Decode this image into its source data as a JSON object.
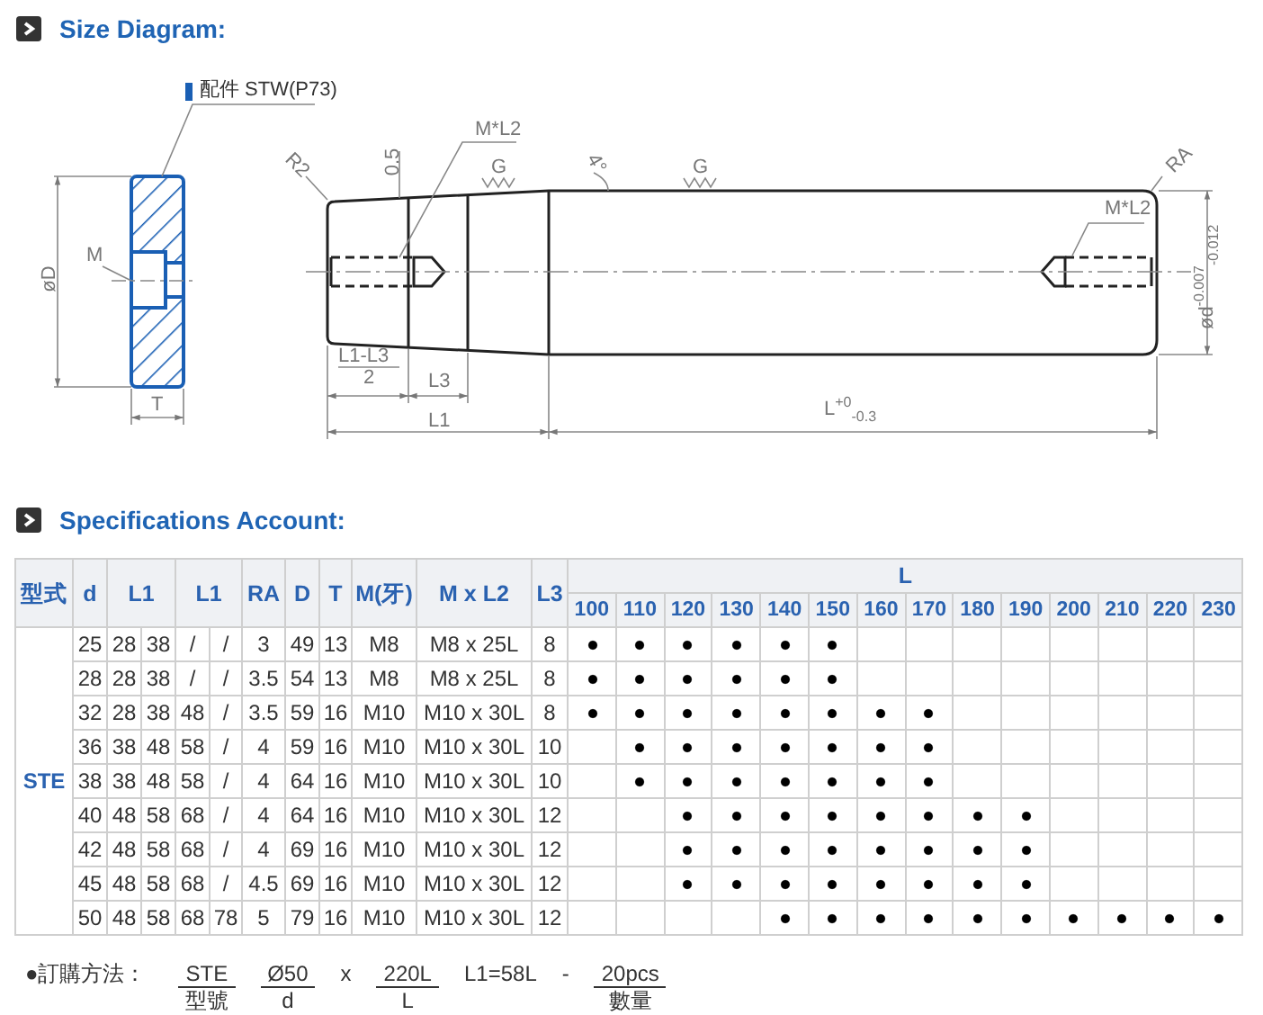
{
  "sections": [
    {
      "title": "Size Diagram:"
    },
    {
      "title": "Specifications Account:"
    }
  ],
  "diagram": {
    "labels": [
      {
        "text": "配件 STW(P73)",
        "kind": "callout"
      },
      {
        "text": "øD",
        "kind": "dimension"
      },
      {
        "text": "M",
        "kind": "dimension"
      },
      {
        "text": "T",
        "kind": "dimension"
      },
      {
        "text": "R2",
        "kind": "dimension"
      },
      {
        "text": "0.5",
        "kind": "dimension"
      },
      {
        "text": "M*L2",
        "kind": "dimension"
      },
      {
        "text": "G",
        "kind": "dimension"
      },
      {
        "text": "4°",
        "kind": "dimension"
      },
      {
        "text": "G",
        "kind": "dimension"
      },
      {
        "text": "RA",
        "kind": "dimension"
      },
      {
        "text": "M*L2",
        "kind": "dimension"
      },
      {
        "text": "ød$^{-0.007}$$_{-0.012}$",
        "kind": "dimension"
      },
      {
        "text": "L1-L3",
        "kind": "dimension"
      },
      {
        "text": "2",
        "kind": "dimension"
      },
      {
        "text": "L3",
        "kind": "dimension"
      },
      {
        "text": "L1",
        "kind": "dimension"
      },
      {
        "text": "L$^{+0}$$_{-0.3}$",
        "kind": "dimension"
      }
    ]
  },
  "table": {
    "columns": [
      {
        "label": "型式",
        "kind": "single"
      },
      {
        "label": "d",
        "kind": "single"
      },
      {
        "label": "L1",
        "kind": "pair"
      },
      {
        "label": "L1",
        "kind": "pair"
      },
      {
        "label": "RA",
        "kind": "single"
      },
      {
        "label": "D",
        "kind": "single"
      },
      {
        "label": "T",
        "kind": "single"
      },
      {
        "label": "M(牙)",
        "kind": "single"
      },
      {
        "label": "M x L2",
        "kind": "single"
      },
      {
        "label": "L3",
        "kind": "single"
      }
    ],
    "length_group": {
      "label": "L",
      "sizes": [
        "100",
        "110",
        "120",
        "130",
        "140",
        "150",
        "160",
        "170",
        "180",
        "190",
        "200",
        "210",
        "220",
        "230"
      ]
    },
    "groups": [
      {
        "type": "STE",
        "rows": [
          {
            "cells": [
              "25",
              "28",
              "38",
              "/",
              "/",
              "3",
              "49",
              "13",
              "M8",
              "M8 x 25L",
              "8"
            ],
            "available": [
              true,
              true,
              true,
              true,
              true,
              true,
              false,
              false,
              false,
              false,
              false,
              false,
              false,
              false
            ]
          },
          {
            "cells": [
              "28",
              "28",
              "38",
              "/",
              "/",
              "3.5",
              "54",
              "13",
              "M8",
              "M8 x 25L",
              "8"
            ],
            "available": [
              true,
              true,
              true,
              true,
              true,
              true,
              false,
              false,
              false,
              false,
              false,
              false,
              false,
              false
            ]
          },
          {
            "cells": [
              "32",
              "28",
              "38",
              "48",
              "/",
              "3.5",
              "59",
              "16",
              "M10",
              "M10 x 30L",
              "8"
            ],
            "available": [
              true,
              true,
              true,
              true,
              true,
              true,
              true,
              true,
              false,
              false,
              false,
              false,
              false,
              false
            ]
          },
          {
            "cells": [
              "36",
              "38",
              "48",
              "58",
              "/",
              "4",
              "59",
              "16",
              "M10",
              "M10 x 30L",
              "10"
            ],
            "available": [
              false,
              true,
              true,
              true,
              true,
              true,
              true,
              true,
              false,
              false,
              false,
              false,
              false,
              false
            ]
          },
          {
            "cells": [
              "38",
              "38",
              "48",
              "58",
              "/",
              "4",
              "64",
              "16",
              "M10",
              "M10 x 30L",
              "10"
            ],
            "available": [
              false,
              true,
              true,
              true,
              true,
              true,
              true,
              true,
              false,
              false,
              false,
              false,
              false,
              false
            ]
          },
          {
            "cells": [
              "40",
              "48",
              "58",
              "68",
              "/",
              "4",
              "64",
              "16",
              "M10",
              "M10 x 30L",
              "12"
            ],
            "available": [
              false,
              false,
              true,
              true,
              true,
              true,
              true,
              true,
              true,
              true,
              false,
              false,
              false,
              false
            ]
          },
          {
            "cells": [
              "42",
              "48",
              "58",
              "68",
              "/",
              "4",
              "69",
              "16",
              "M10",
              "M10 x 30L",
              "12"
            ],
            "available": [
              false,
              false,
              true,
              true,
              true,
              true,
              true,
              true,
              true,
              true,
              false,
              false,
              false,
              false
            ]
          },
          {
            "cells": [
              "45",
              "48",
              "58",
              "68",
              "/",
              "4.5",
              "69",
              "16",
              "M10",
              "M10 x 30L",
              "12"
            ],
            "available": [
              false,
              false,
              true,
              true,
              true,
              true,
              true,
              true,
              true,
              true,
              false,
              false,
              false,
              false
            ]
          },
          {
            "cells": [
              "50",
              "48",
              "58",
              "68",
              "78",
              "5",
              "79",
              "16",
              "M10",
              "M10 x 30L",
              "12"
            ],
            "available": [
              false,
              false,
              false,
              false,
              true,
              true,
              true,
              true,
              true,
              true,
              true,
              true,
              true,
              true
            ]
          }
        ]
      }
    ]
  },
  "order": {
    "label": "●訂購方法：",
    "items": [
      {
        "kind": "fraction",
        "top": "STE",
        "bottom": "型號"
      },
      {
        "kind": "fraction",
        "top": "Ø50",
        "bottom": "d"
      },
      {
        "kind": "text",
        "text": "x"
      },
      {
        "kind": "fraction",
        "top": "220L",
        "bottom": "L"
      },
      {
        "kind": "text",
        "text": "L1=58L"
      },
      {
        "kind": "text",
        "text": "-"
      },
      {
        "kind": "fraction",
        "top": "20pcs",
        "bottom": "數量"
      }
    ]
  }
}
